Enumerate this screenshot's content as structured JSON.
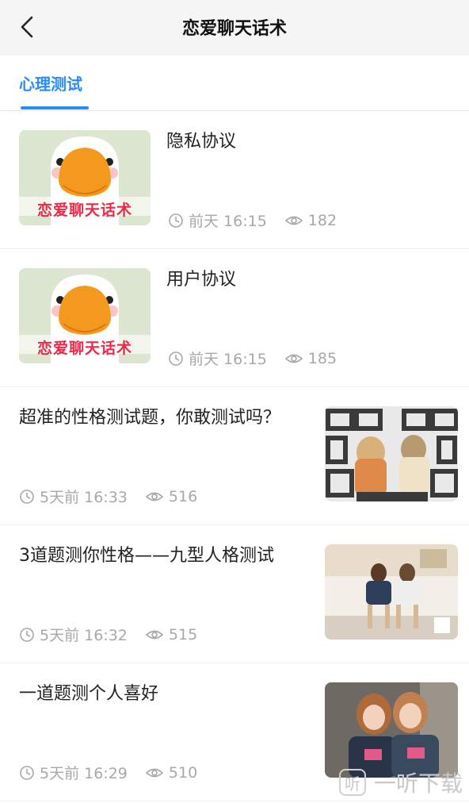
{
  "header": {
    "title": "恋爱聊天话术",
    "back_icon": "chevron-left-icon"
  },
  "tabs": [
    {
      "label": "心理测试",
      "active": true
    }
  ],
  "accent_color": "#2a8cf4",
  "articles": [
    {
      "title": "隐私协议",
      "time": "前天 16:15",
      "views": "182",
      "thumb_text": "恋爱聊天话术"
    },
    {
      "title": "用户协议",
      "time": "前天 16:15",
      "views": "185",
      "thumb_text": "恋爱聊天话术"
    },
    {
      "title": "超准的性格测试题，你敢测试吗？",
      "time": "5天前 16:33",
      "views": "516"
    },
    {
      "title": "3道题测你性格——九型人格测试",
      "time": "5天前 16:32",
      "views": "515"
    },
    {
      "title": "一道题测个人喜好",
      "time": "5天前 16:29",
      "views": "510"
    }
  ],
  "watermark": {
    "glyph": "听",
    "text": "一听下载"
  }
}
